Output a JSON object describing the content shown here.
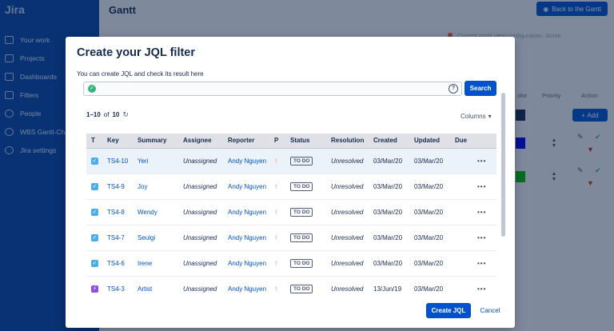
{
  "app": {
    "logo": "Jira",
    "page_title": "Gantt",
    "back_label": "Back to the Gantt",
    "warning_text": "Current gantt view configuration. Some"
  },
  "sidebar": {
    "items": [
      {
        "label": "Your work",
        "icon": "board-icon"
      },
      {
        "label": "Projects",
        "icon": "folder-icon"
      },
      {
        "label": "Dashboards",
        "icon": "dashboard-icon"
      },
      {
        "label": "Filters",
        "icon": "filter-icon"
      },
      {
        "label": "People",
        "icon": "people-icon"
      },
      {
        "label": "WBS Gantt-Cha",
        "icon": "gear-icon"
      },
      {
        "label": "Jira settings",
        "icon": "settings-icon"
      }
    ]
  },
  "background_table": {
    "col_color": "olor",
    "col_priority": "Priority",
    "col_action": "Action",
    "add_label": "Add",
    "swatches": [
      "#172b4d",
      "#0000ee",
      "#00c000"
    ]
  },
  "modal": {
    "title": "Create your JQL filter",
    "description": "You can create JQL and check its result here",
    "jql_value": "",
    "search_label": "Search",
    "count_range": "1–10",
    "count_of": "of",
    "count_total": "10",
    "columns_label": "Columns",
    "create_label": "Create JQL",
    "cancel_label": "Cancel",
    "table": {
      "headers": [
        "T",
        "Key",
        "Summary",
        "Assignee",
        "Reporter",
        "P",
        "Status",
        "Resolution",
        "Created",
        "Updated",
        "Due"
      ],
      "rows": [
        {
          "type": "task",
          "key": "TS4-10",
          "summary": "Yeri",
          "assignee": "Unassigned",
          "reporter": "Andy Nguyen",
          "status": "TO DO",
          "resolution": "Unresolved",
          "created": "03/Mar/20",
          "updated": "03/Mar/20",
          "due": ""
        },
        {
          "type": "task",
          "key": "TS4-9",
          "summary": "Joy",
          "assignee": "Unassigned",
          "reporter": "Andy Nguyen",
          "status": "TO DO",
          "resolution": "Unresolved",
          "created": "03/Mar/20",
          "updated": "03/Mar/20",
          "due": ""
        },
        {
          "type": "task",
          "key": "TS4-8",
          "summary": "Wendy",
          "assignee": "Unassigned",
          "reporter": "Andy Nguyen",
          "status": "TO DO",
          "resolution": "Unresolved",
          "created": "03/Mar/20",
          "updated": "03/Mar/20",
          "due": ""
        },
        {
          "type": "task",
          "key": "TS4-7",
          "summary": "Seulgi",
          "assignee": "Unassigned",
          "reporter": "Andy Nguyen",
          "status": "TO DO",
          "resolution": "Unresolved",
          "created": "03/Mar/20",
          "updated": "03/Mar/20",
          "due": ""
        },
        {
          "type": "task",
          "key": "TS4-6",
          "summary": "Irene",
          "assignee": "Unassigned",
          "reporter": "Andy Nguyen",
          "status": "TO DO",
          "resolution": "Unresolved",
          "created": "03/Mar/20",
          "updated": "03/Mar/20",
          "due": ""
        },
        {
          "type": "epic",
          "key": "TS4-3",
          "summary": "Artist",
          "assignee": "Unassigned",
          "reporter": "Andy Nguyen",
          "status": "TO DO",
          "resolution": "Unresolved",
          "created": "13/Jun/19",
          "updated": "03/Mar/20",
          "due": ""
        }
      ]
    }
  }
}
